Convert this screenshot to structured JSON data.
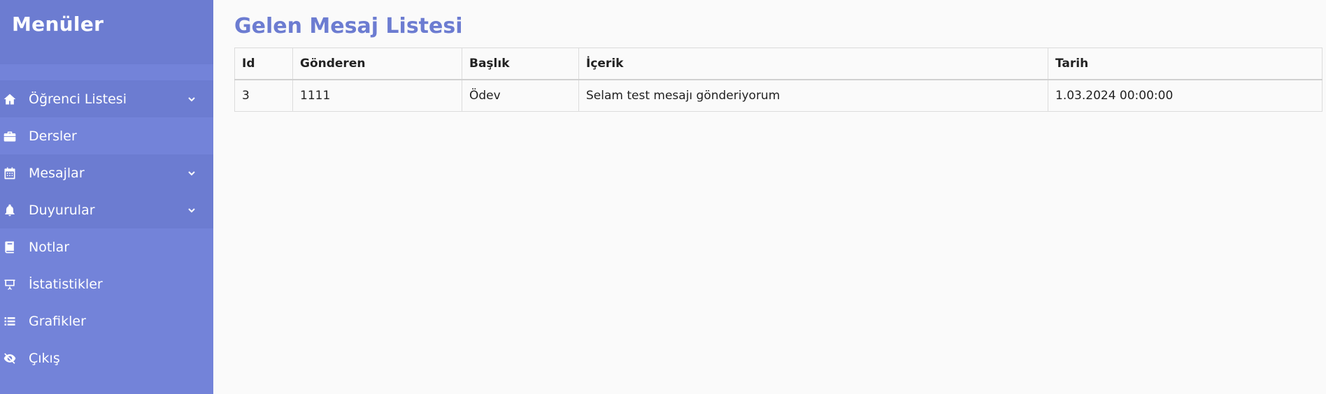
{
  "sidebar": {
    "title": "Menüler",
    "items": [
      {
        "label": "Öğrenci Listesi",
        "icon": "home-icon",
        "has_dropdown": true
      },
      {
        "label": "Dersler",
        "icon": "briefcase-icon",
        "has_dropdown": false
      },
      {
        "label": "Mesajlar",
        "icon": "calendar-icon",
        "has_dropdown": true
      },
      {
        "label": "Duyurular",
        "icon": "bell-icon",
        "has_dropdown": true
      },
      {
        "label": "Notlar",
        "icon": "book-icon",
        "has_dropdown": false
      },
      {
        "label": "İstatistikler",
        "icon": "presentation-icon",
        "has_dropdown": false
      },
      {
        "label": "Grafikler",
        "icon": "list-icon",
        "has_dropdown": false
      },
      {
        "label": "Çıkış",
        "icon": "eye-slash-icon",
        "has_dropdown": false
      }
    ]
  },
  "main": {
    "title": "Gelen Mesaj Listesi",
    "table": {
      "headers": [
        "Id",
        "Gönderen",
        "Başlık",
        "İçerik",
        "Tarih"
      ],
      "rows": [
        [
          "3",
          "1111",
          "Ödev",
          "Selam test mesajı gönderiyorum",
          "1.03.2024 00:00:00"
        ]
      ]
    }
  },
  "colors": {
    "sidebar_bg": "#7383d9",
    "sidebar_dark": "#6c7cd1",
    "accent": "#6c7cd1",
    "page_bg": "#fafafa"
  }
}
